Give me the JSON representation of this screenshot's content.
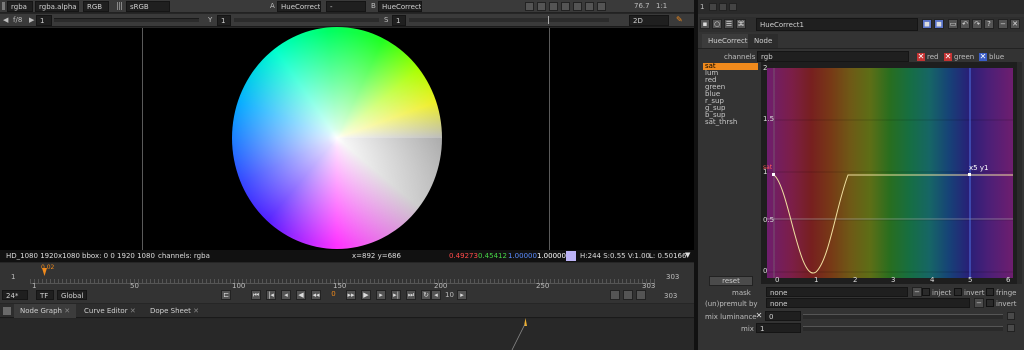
{
  "viewer": {
    "toolbar1": {
      "layer": "rgba",
      "alpha": "rgba.alpha",
      "colorspace": "RGB",
      "lut": "sRGB",
      "input_a_label": "A",
      "input_a": "HueCorrect1",
      "compare": "-",
      "input_b_label": "B",
      "input_b": "HueCorrect1",
      "zoom": "76.7",
      "ratio": "1:1"
    },
    "toolbar2": {
      "fstop": "f/8",
      "frame_label": "1",
      "y_label": "Y",
      "y_value": "1",
      "s_label": "S",
      "s_value": "1",
      "view_mode": "2D"
    },
    "status": {
      "format": "HD_1080 1920x1080",
      "bbox": "bbox: 0 0 1920 1080",
      "channels": "channels: rgba",
      "coords": "x=892 y=686",
      "r": "0.49273",
      "g": "0.45412",
      "b": "1.00000",
      "a": "1.00000",
      "hsv": "H:244 S:0.55 V:1.00",
      "l": "L: 0.50166"
    }
  },
  "timeline": {
    "start_frame": "1",
    "end_frame": "303",
    "end_frame2": "303",
    "ticks": [
      "1",
      "50",
      "100",
      "150",
      "200",
      "250",
      "303"
    ],
    "current_frame": "0.02",
    "fps": "24*",
    "tf": "TF",
    "scope": "Global",
    "frame_field": "0",
    "step": "10"
  },
  "bottom_tabs": [
    "Node Graph",
    "Curve Editor",
    "Dope Sheet"
  ],
  "properties": {
    "panel_number": "1",
    "node_name": "HueCorrect1",
    "tabs": [
      "HueCorrect",
      "Node"
    ],
    "channels_label": "channels",
    "channels_value": "rgb",
    "channel_red": "red",
    "channel_green": "green",
    "channel_blue": "blue",
    "curves": [
      "sat",
      "lum",
      "red",
      "green",
      "blue",
      "r_sup",
      "g_sup",
      "b_sup",
      "sat_thrsh"
    ],
    "reset_label": "reset",
    "graph": {
      "y_ticks": [
        "2",
        "1.5",
        "1",
        "0.5",
        "0"
      ],
      "x_ticks": [
        "0",
        "1",
        "2",
        "3",
        "4",
        "5",
        "6"
      ],
      "curve_label": "sat",
      "point_label": "x5 y1"
    },
    "mask_label": "mask",
    "mask_value": "none",
    "inject_label": "inject",
    "invert_label": "invert",
    "fringe_label": "fringe",
    "premult_label": "(un)premult by",
    "premult_value": "none",
    "invert2_label": "invert",
    "mix_lum_label": "mix luminance",
    "mix_lum_value": "0",
    "mix_label": "mix",
    "mix_value": "1"
  },
  "colors": {
    "accent": "#f08a1c",
    "panel": "#3a3a3a",
    "graph_bg": "#1e1e1e"
  }
}
